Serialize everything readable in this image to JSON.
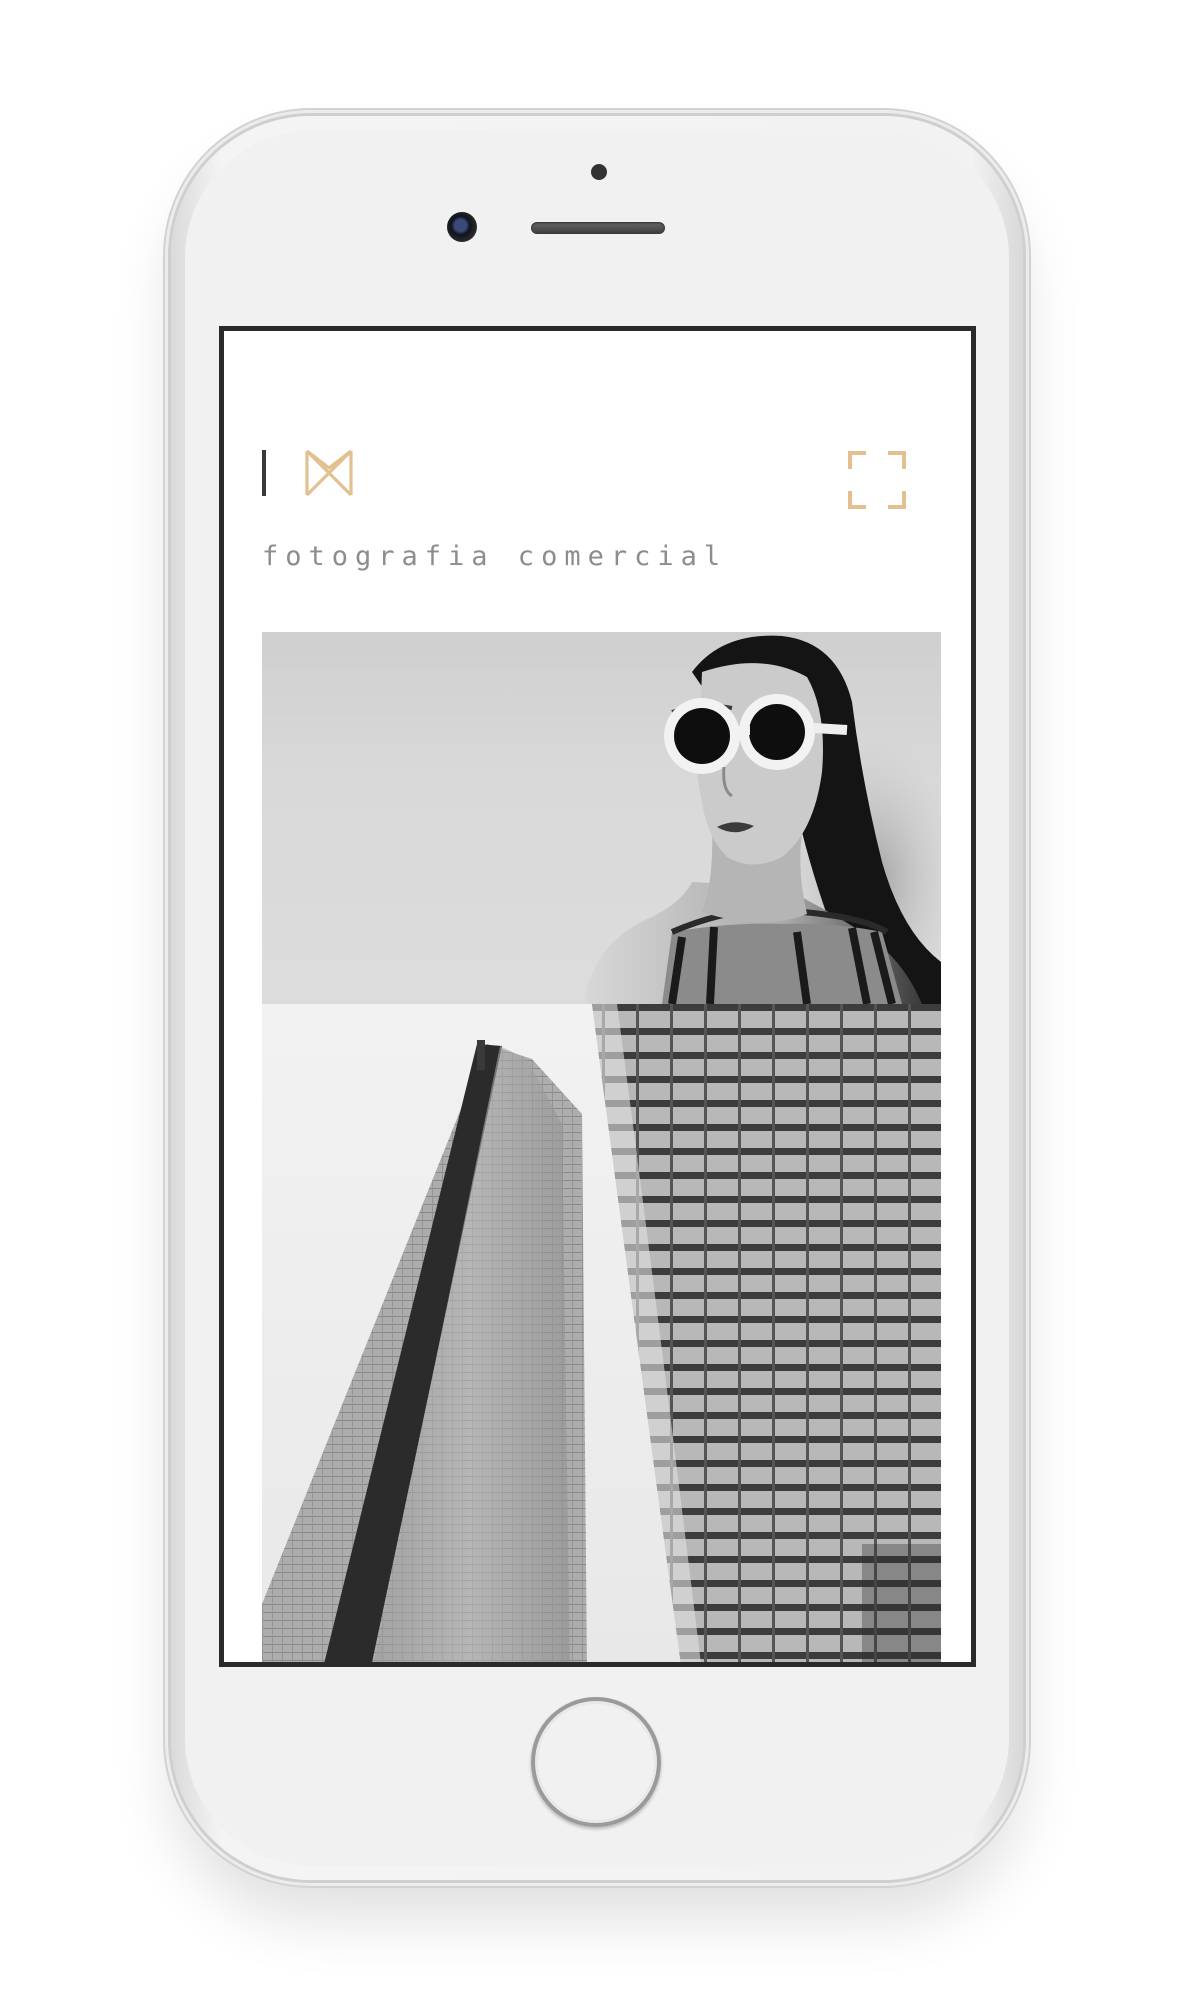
{
  "header": {
    "tagline": "fotografia comercial"
  },
  "colors": {
    "accent_gold": "#e2c08f",
    "screen_background": "#ffffff",
    "tagline_text": "#8d8d8d"
  },
  "icons": {
    "logo": "bowtie-monogram-icon",
    "menu": "fullscreen-expand-icon"
  },
  "gallery": [
    {
      "subject": "woman-with-white-round-sunglasses"
    },
    {
      "subject": "skyscrapers-black-and-white"
    }
  ]
}
